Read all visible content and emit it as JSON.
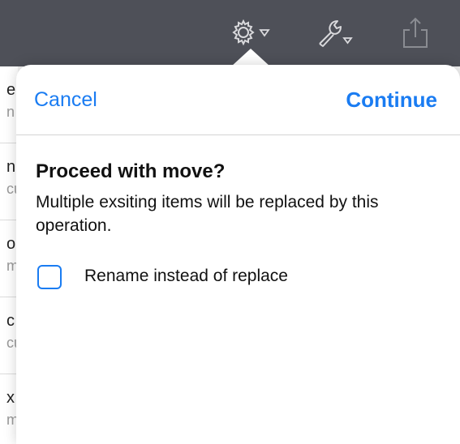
{
  "toolbar": {
    "icons": [
      "gear-menu-icon",
      "wrench-menu-icon",
      "share-icon"
    ],
    "background": "#4e5058",
    "icon_color": "#d9d9dc"
  },
  "background_list": {
    "rows": [
      {
        "line1": "e",
        "line2": "n"
      },
      {
        "line1": "n",
        "line2": "cu"
      },
      {
        "line1": "o",
        "line2": "m"
      },
      {
        "line1": "c",
        "line2": "cu"
      },
      {
        "line1": "x",
        "line2": "m"
      }
    ]
  },
  "dialog": {
    "cancel_label": "Cancel",
    "continue_label": "Continue",
    "title": "Proceed with move?",
    "message": "Multiple exsiting items will be replaced by this operation.",
    "option": {
      "label": "Rename instead of replace",
      "checked": false
    }
  },
  "colors": {
    "accent": "#1a7cf2",
    "text": "#111111",
    "secondary_text": "#9a9a9a"
  }
}
